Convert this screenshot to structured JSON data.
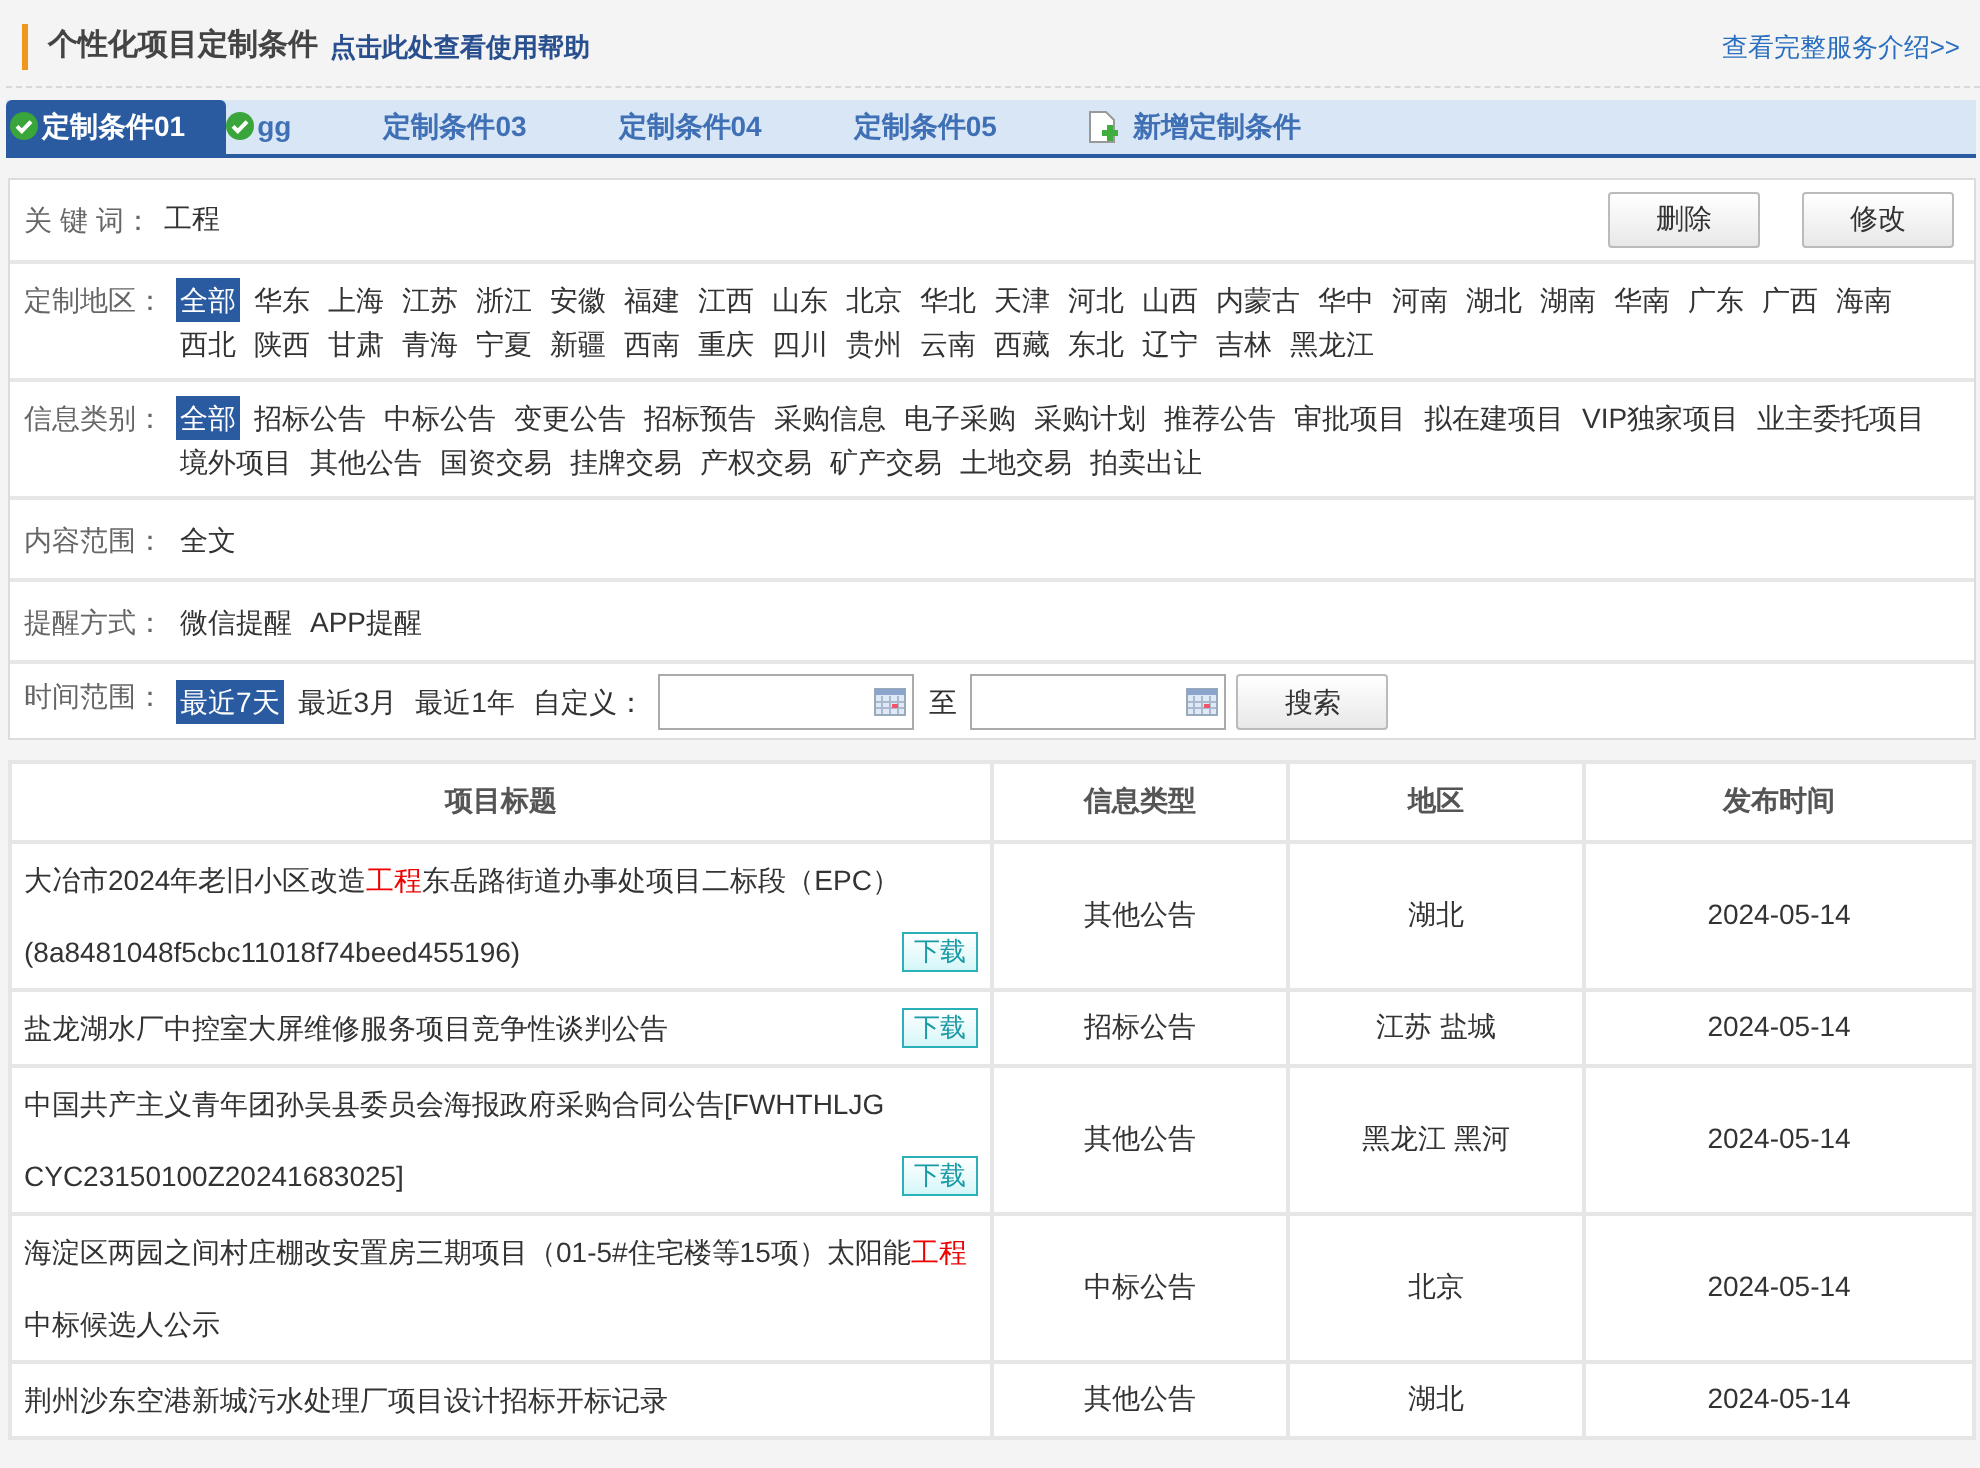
{
  "header": {
    "title": "个性化项目定制条件",
    "help_link": "点击此处查看使用帮助",
    "service_link": "查看完整服务介绍>>"
  },
  "tabs": [
    {
      "kind": "condition",
      "label": "定制条件01",
      "checked": true,
      "selected": true
    },
    {
      "kind": "condition",
      "label": "gg",
      "checked": true,
      "selected": false
    },
    {
      "kind": "condition",
      "label": "定制条件03",
      "checked": false,
      "selected": false
    },
    {
      "kind": "condition",
      "label": "定制条件04",
      "checked": false,
      "selected": false
    },
    {
      "kind": "condition",
      "label": "定制条件05",
      "checked": false,
      "selected": false
    },
    {
      "kind": "add",
      "label": "新增定制条件",
      "checked": false,
      "selected": false
    }
  ],
  "filters": [
    {
      "kind": "keyword",
      "label": "关 键 词：",
      "value": "工程",
      "buttons": [
        "删除",
        "修改"
      ]
    },
    {
      "kind": "options",
      "label": "定制地区：",
      "options": [
        {
          "text": "全部",
          "selected": true
        },
        {
          "text": "华东",
          "selected": false
        },
        {
          "text": "上海",
          "selected": false
        },
        {
          "text": "江苏",
          "selected": false
        },
        {
          "text": "浙江",
          "selected": false
        },
        {
          "text": "安徽",
          "selected": false
        },
        {
          "text": "福建",
          "selected": false
        },
        {
          "text": "江西",
          "selected": false
        },
        {
          "text": "山东",
          "selected": false
        },
        {
          "text": "北京",
          "selected": false
        },
        {
          "text": "华北",
          "selected": false
        },
        {
          "text": "天津",
          "selected": false
        },
        {
          "text": "河北",
          "selected": false
        },
        {
          "text": "山西",
          "selected": false
        },
        {
          "text": "内蒙古",
          "selected": false
        },
        {
          "text": "华中",
          "selected": false
        },
        {
          "text": "河南",
          "selected": false
        },
        {
          "text": "湖北",
          "selected": false
        },
        {
          "text": "湖南",
          "selected": false
        },
        {
          "text": "华南",
          "selected": false
        },
        {
          "text": "广东",
          "selected": false
        },
        {
          "text": "广西",
          "selected": false
        },
        {
          "text": "海南",
          "selected": false
        },
        {
          "text": "西北",
          "selected": false
        },
        {
          "text": "陕西",
          "selected": false
        },
        {
          "text": "甘肃",
          "selected": false
        },
        {
          "text": "青海",
          "selected": false
        },
        {
          "text": "宁夏",
          "selected": false
        },
        {
          "text": "新疆",
          "selected": false
        },
        {
          "text": "西南",
          "selected": false
        },
        {
          "text": "重庆",
          "selected": false
        },
        {
          "text": "四川",
          "selected": false
        },
        {
          "text": "贵州",
          "selected": false
        },
        {
          "text": "云南",
          "selected": false
        },
        {
          "text": "西藏",
          "selected": false
        },
        {
          "text": "东北",
          "selected": false
        },
        {
          "text": "辽宁",
          "selected": false
        },
        {
          "text": "吉林",
          "selected": false
        },
        {
          "text": "黑龙江",
          "selected": false
        }
      ]
    },
    {
      "kind": "options",
      "label": "信息类别：",
      "options": [
        {
          "text": "全部",
          "selected": true
        },
        {
          "text": "招标公告",
          "selected": false
        },
        {
          "text": "中标公告",
          "selected": false
        },
        {
          "text": "变更公告",
          "selected": false
        },
        {
          "text": "招标预告",
          "selected": false
        },
        {
          "text": "采购信息",
          "selected": false
        },
        {
          "text": "电子采购",
          "selected": false
        },
        {
          "text": "采购计划",
          "selected": false
        },
        {
          "text": "推荐公告",
          "selected": false
        },
        {
          "text": "审批项目",
          "selected": false
        },
        {
          "text": "拟在建项目",
          "selected": false
        },
        {
          "text": "VIP独家项目",
          "selected": false
        },
        {
          "text": "业主委托项目",
          "selected": false
        },
        {
          "text": "境外项目",
          "selected": false
        },
        {
          "text": "其他公告",
          "selected": false
        },
        {
          "text": "国资交易",
          "selected": false
        },
        {
          "text": "挂牌交易",
          "selected": false
        },
        {
          "text": "产权交易",
          "selected": false
        },
        {
          "text": "矿产交易",
          "selected": false
        },
        {
          "text": "土地交易",
          "selected": false
        },
        {
          "text": "拍卖出让",
          "selected": false
        }
      ]
    },
    {
      "kind": "options",
      "label": "内容范围：",
      "options": [
        {
          "text": "全文",
          "selected": false
        }
      ]
    },
    {
      "kind": "options",
      "label": "提醒方式：",
      "options": [
        {
          "text": "微信提醒",
          "selected": false
        },
        {
          "text": "APP提醒",
          "selected": false
        }
      ]
    },
    {
      "kind": "time",
      "label": "时间范围：",
      "options": [
        {
          "text": "最近7天",
          "selected": true
        },
        {
          "text": "最近3月",
          "selected": false
        },
        {
          "text": "最近1年",
          "selected": false
        }
      ],
      "custom_label": "自定义：",
      "separator": "至",
      "button": "搜索"
    }
  ],
  "table": {
    "columns": [
      "项目标题",
      "信息类型",
      "地区",
      "发布时间"
    ],
    "rows": [
      {
        "title": [
          {
            "text": "大冶市2024年老旧小区改造",
            "highlight": false
          },
          {
            "text": "工程",
            "highlight": true
          },
          {
            "text": "东岳路街道办事处项目二标段（EPC）(8a8481048f5cbc11018f74beed455196)",
            "highlight": false
          }
        ],
        "download": "下载",
        "type": "其他公告",
        "region": "湖北",
        "date": "2024-05-14"
      },
      {
        "title": [
          {
            "text": "盐龙湖水厂中控室大屏维修服务项目竞争性谈判公告",
            "highlight": false
          }
        ],
        "download": "下载",
        "type": "招标公告",
        "region": "江苏 盐城",
        "date": "2024-05-14"
      },
      {
        "title": [
          {
            "text": "中国共产主义青年团孙吴县委员会海报政府采购合同公告[FWHTHLJGCYC23150100Z20241683025]",
            "highlight": false
          }
        ],
        "download": "下载",
        "type": "其他公告",
        "region": "黑龙江 黑河",
        "date": "2024-05-14"
      },
      {
        "title": [
          {
            "text": "海淀区两园之间村庄棚改安置房三期项目（01-5#住宅楼等15项）太阳能",
            "highlight": false
          },
          {
            "text": "工程",
            "highlight": true
          },
          {
            "text": "中标候选人公示",
            "highlight": false
          }
        ],
        "type": "中标公告",
        "region": "北京",
        "date": "2024-05-14"
      },
      {
        "title": [
          {
            "text": "荆州沙东空港新城污水处理厂项目设计招标开标记录",
            "highlight": false
          }
        ],
        "type": "其他公告",
        "region": "湖北",
        "date": "2024-05-14"
      }
    ]
  }
}
